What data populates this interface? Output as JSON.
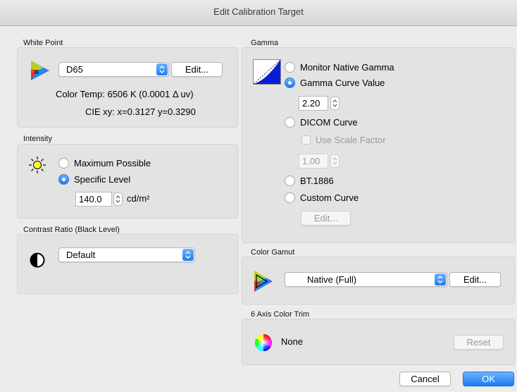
{
  "window": {
    "title": "Edit Calibration Target"
  },
  "white_point": {
    "label": "White Point",
    "selected": "D65",
    "edit_label": "Edit...",
    "color_temp": "Color Temp: 6506 K (0.0001 Δ uv)",
    "cie_xy": "CIE xy:  x=0.3127 y=0.3290"
  },
  "intensity": {
    "label": "Intensity",
    "options": [
      "Maximum Possible",
      "Specific Level"
    ],
    "level_value": "140.0",
    "unit": "cd/m²"
  },
  "contrast": {
    "label": "Contrast Ratio (Black Level)",
    "selected": "Default"
  },
  "gamma": {
    "label": "Gamma",
    "options": {
      "native": "Monitor Native Gamma",
      "curve_value": "Gamma Curve Value",
      "dicom": "DICOM Curve",
      "scale_factor": "Use Scale Factor",
      "bt1886": "BT.1886",
      "custom": "Custom Curve"
    },
    "gamma_value": "2.20",
    "scale_value": "1.00",
    "edit_label": "Edit..."
  },
  "gamut": {
    "label": "Color Gamut",
    "selected": "Native (Full)",
    "edit_label": "Edit..."
  },
  "trim": {
    "label": "6 Axis Color Trim",
    "value": "None",
    "reset_label": "Reset"
  },
  "footer": {
    "cancel_label": "Cancel",
    "ok_label": "OK"
  },
  "colors": {
    "accent": "#1e7ef5",
    "panel": "#e3e3e3",
    "window": "#ececec"
  }
}
